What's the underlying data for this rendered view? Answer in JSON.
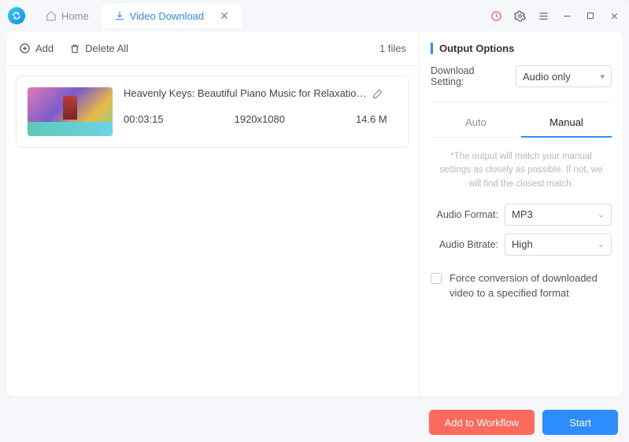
{
  "tabs": {
    "home": "Home",
    "video_download": "Video Download"
  },
  "toolbar": {
    "add": "Add",
    "delete_all": "Delete All",
    "files_count": "1 files"
  },
  "item": {
    "title": "Heavenly Keys: Beautiful Piano Music for Relaxation and Me…",
    "duration": "00:03:15",
    "resolution": "1920x1080",
    "size": "14.6 M"
  },
  "output": {
    "section_title": "Output Options",
    "download_setting_label": "Download Setting:",
    "download_setting_value": "Audio only",
    "subtabs": {
      "auto": "Auto",
      "manual": "Manual"
    },
    "note": "*The output will match your manual settings as closely as possible. If not, we will find the closest match.",
    "audio_format_label": "Audio Format:",
    "audio_format_value": "MP3",
    "audio_bitrate_label": "Audio Bitrate:",
    "audio_bitrate_value": "High",
    "force_convert": "Force conversion of downloaded video to a specified format"
  },
  "footer": {
    "add_workflow": "Add to Workflow",
    "start": "Start"
  }
}
